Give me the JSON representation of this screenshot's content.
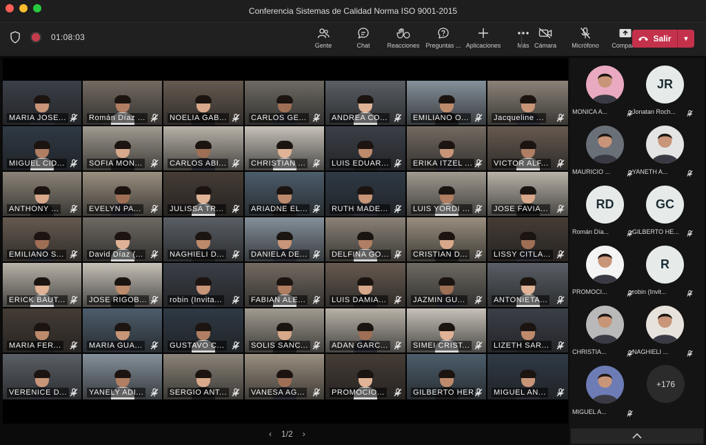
{
  "window": {
    "title": "Conferencia Sistemas de Calidad Norma ISO 9001-2015"
  },
  "meeting": {
    "elapsed": "01:08:03"
  },
  "toolbar": [
    {
      "label": "Gente",
      "icon": "people-icon"
    },
    {
      "label": "Chat",
      "icon": "chat-icon"
    },
    {
      "label": "Reacciones",
      "icon": "reactions-icon"
    },
    {
      "label": "Preguntas ...",
      "icon": "questions-icon"
    },
    {
      "label": "Aplicaciones",
      "icon": "plus-icon"
    },
    {
      "label": "Más",
      "icon": "more-icon"
    }
  ],
  "toolbar_right": [
    {
      "label": "Cámara",
      "icon": "camera-off-icon"
    },
    {
      "label": "Micrófono",
      "icon": "mic-off-icon"
    },
    {
      "label": "Comparte",
      "icon": "share-icon"
    }
  ],
  "leave": {
    "label": "Salir"
  },
  "grid": {
    "tiles": [
      "MARIA JOSE...",
      "Román Díaz ...",
      "NOELIA GAB...",
      "CARLOS GE...",
      "ANDREA CO...",
      "EMILIANO O...",
      "Jacqueline ...",
      "MIGUEL CID...",
      "SOFIA MON...",
      "CARLOS ABI...",
      "CHRISTIAN ...",
      "LUIS EDUAR...",
      "ERIKA ITZEL ...",
      "VICTOR ALF...",
      "ANTHONY ...",
      "EVELYN PA...",
      "JULISSA TR...",
      "ARIADNE EL...",
      "RUTH MADE...",
      "LUIS YORDI ...",
      "JOSE FAVIA...",
      "EMILIANO S...",
      "David Díaz (...",
      "NAGHIELI D...",
      "DANIELA DE...",
      "DELFINA GO...",
      "CRISTIAN D...",
      "LISSY CITLA...",
      "ERICK BAUT...",
      "JOSE RIGOB...",
      "robin (Invita...",
      "FABIAN ALE...",
      "LUIS DAMIA...",
      "JAZMIN GU...",
      "ANTONIETA...",
      "MARIA FER...",
      "MARIA GUA...",
      "GUSTAVO C...",
      "SOLIS SANC...",
      "ADAN GARC...",
      "SIMEI CRIST...",
      "LIZETH SAR...",
      "VERENICE D...",
      "YANELY ADI...",
      "SERGIO ANT...",
      "VANESA AG...",
      "PROMOCIO...",
      "GILBERTO HER...",
      "MIGUEL AN..."
    ],
    "page": "1/2"
  },
  "panel": {
    "participants": [
      {
        "name": "MONICA A...",
        "initials": ""
      },
      {
        "name": "Jonatan Roch...",
        "initials": "JR"
      },
      {
        "name": "MAURICIO ...",
        "initials": ""
      },
      {
        "name": "YANETH A...",
        "initials": ""
      },
      {
        "name": "Román Día...",
        "initials": "RD"
      },
      {
        "name": "GILBERTO HE...",
        "initials": "GC"
      },
      {
        "name": "PROMOCI...",
        "initials": ""
      },
      {
        "name": "robin (Invit...",
        "initials": "R"
      },
      {
        "name": "CHRISTIA...",
        "initials": ""
      },
      {
        "name": "NAGHIELI ...",
        "initials": ""
      },
      {
        "name": "MIGUEL A...",
        "initials": ""
      }
    ],
    "more_count": "+176"
  },
  "colors": {
    "leave": "#c4314b",
    "avatar_gray": "#e6ebea",
    "accent": "#6264a7"
  }
}
